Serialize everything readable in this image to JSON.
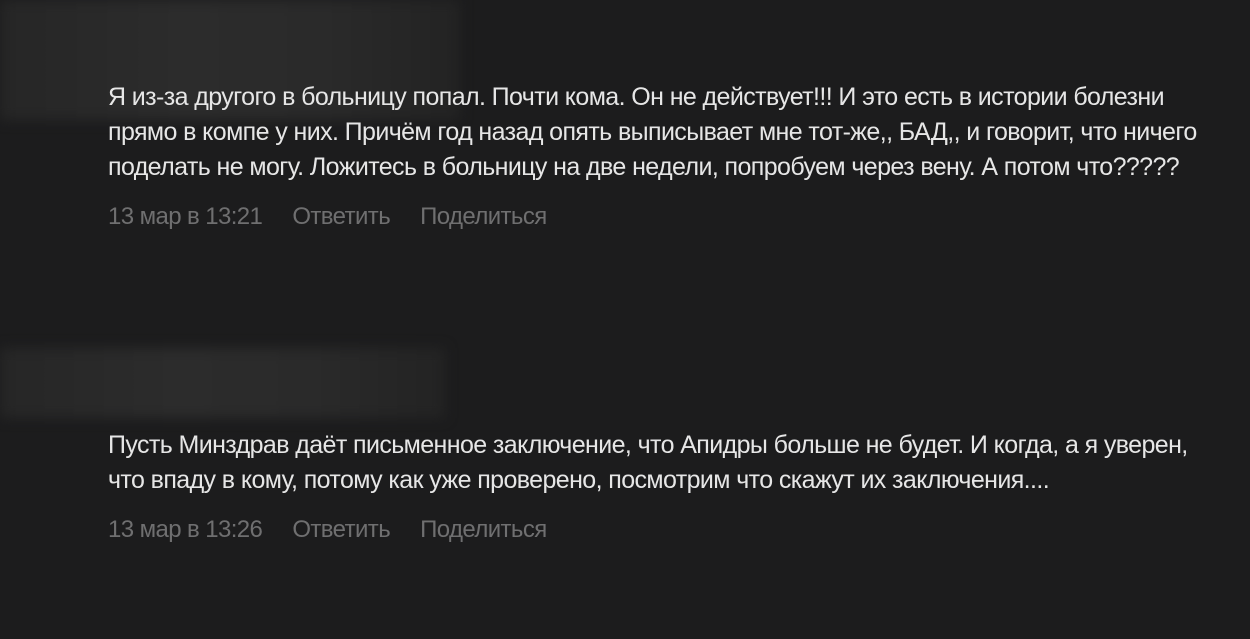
{
  "comments": [
    {
      "text": "Я из-за другого в больницу попал. Почти кома. Он не действует!!! И это есть в истории болезни прямо в компе у них. Причём год назад опять выписывает мне тот-же,, БАД,, и говорит, что ничего поделать не могу. Ложитесь в больницу на две недели, попробуем через вену. А потом что?????",
      "time": "13 мар в 13:21",
      "reply_label": "Ответить",
      "share_label": "Поделиться"
    },
    {
      "text": "Пусть Минздрав даёт письменное заключение, что Апидры больше не будет. И когда, а я уверен, что впаду в кому, потому как уже проверено, посмотрим что скажут их заключения....",
      "time": "13 мар в 13:26",
      "reply_label": "Ответить",
      "share_label": "Поделиться"
    }
  ]
}
